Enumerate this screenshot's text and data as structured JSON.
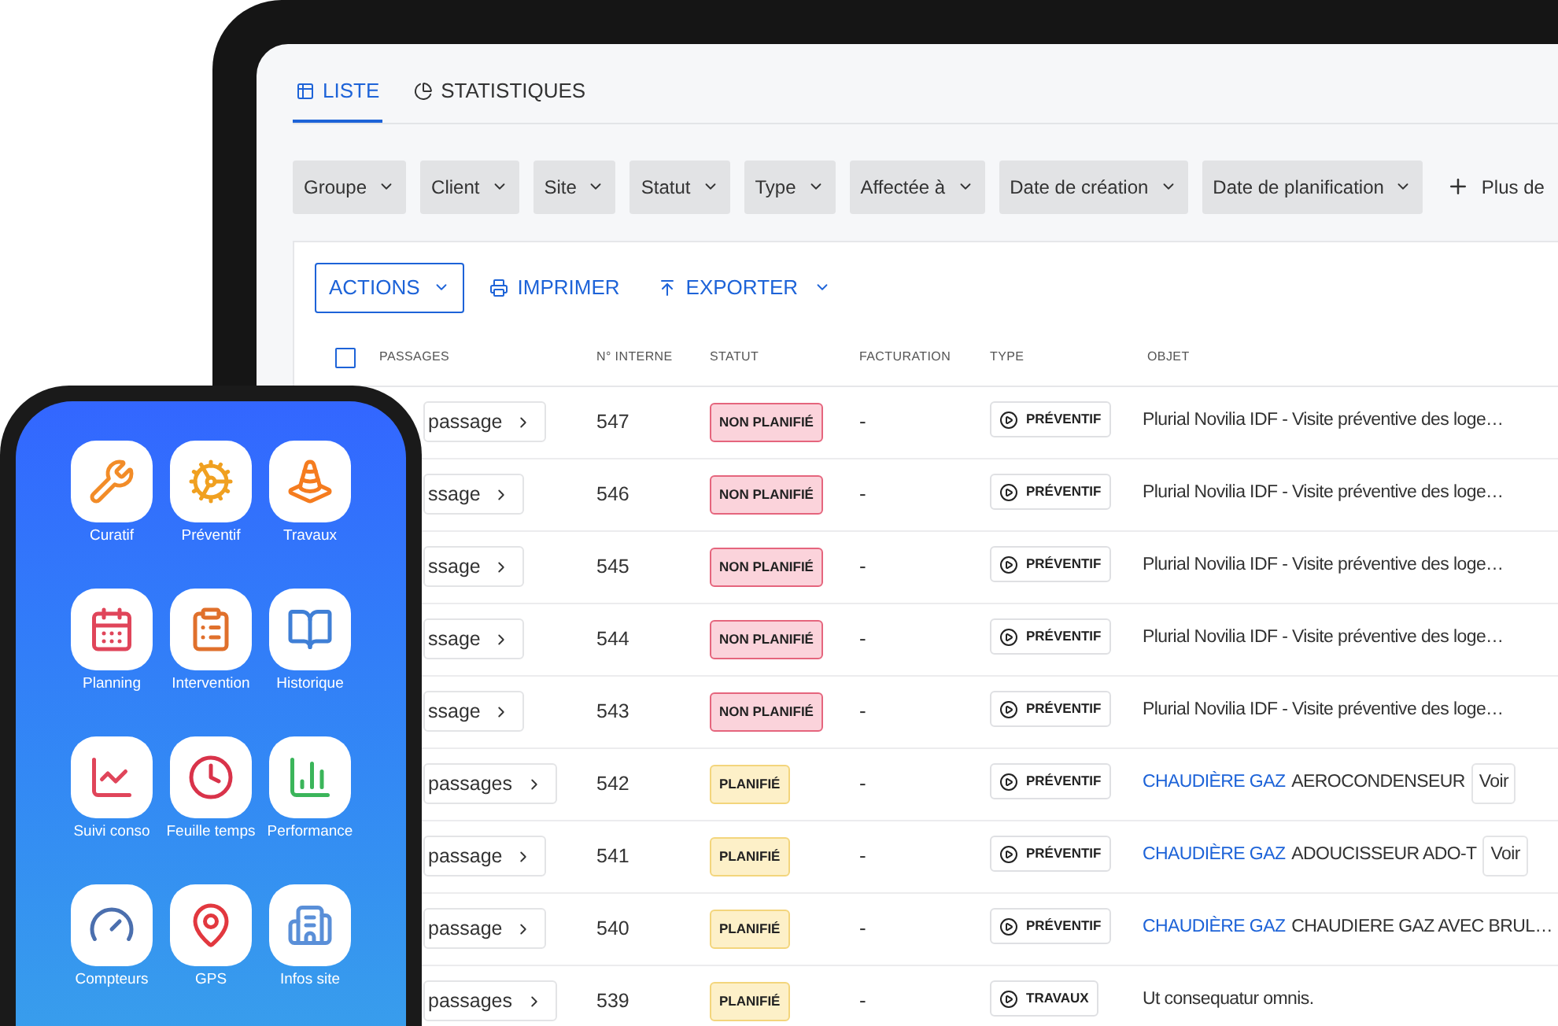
{
  "tabs": [
    {
      "label": "LISTE",
      "selected": true
    },
    {
      "label": "STATISTIQUES",
      "selected": false
    }
  ],
  "filters": [
    "Groupe",
    "Client",
    "Site",
    "Statut",
    "Type",
    "Affectée à",
    "Date de création",
    "Date de planification"
  ],
  "more_filters": "Plus de",
  "toolbar": {
    "actions": "ACTIONS",
    "print": "IMPRIMER",
    "export": "EXPORTER"
  },
  "table": {
    "select_all_checked": false,
    "columns": [
      "PASSAGES",
      "N° INTERNE",
      "STATUT",
      "FACTURATION",
      "TYPE",
      "OBJET"
    ],
    "rows": [
      {
        "passages": "passage",
        "number": "547",
        "status": {
          "label": "NON PLANIFIÉ",
          "kind": "unplanned"
        },
        "billing": "-",
        "type": "PRÉVENTIF",
        "object": {
          "text": "Plurial Novilia IDF - Visite préventive des loge…"
        }
      },
      {
        "passages": "ssage",
        "number": "546",
        "status": {
          "label": "NON PLANIFIÉ",
          "kind": "unplanned"
        },
        "billing": "-",
        "type": "PRÉVENTIF",
        "object": {
          "text": "Plurial Novilia IDF - Visite préventive des loge…"
        }
      },
      {
        "passages": "ssage",
        "number": "545",
        "status": {
          "label": "NON PLANIFIÉ",
          "kind": "unplanned"
        },
        "billing": "-",
        "type": "PRÉVENTIF",
        "object": {
          "text": "Plurial Novilia IDF - Visite préventive des loge…"
        }
      },
      {
        "passages": "ssage",
        "number": "544",
        "status": {
          "label": "NON PLANIFIÉ",
          "kind": "unplanned"
        },
        "billing": "-",
        "type": "PRÉVENTIF",
        "object": {
          "text": "Plurial Novilia IDF - Visite préventive des loge…"
        }
      },
      {
        "passages": "ssage",
        "number": "543",
        "status": {
          "label": "NON PLANIFIÉ",
          "kind": "unplanned"
        },
        "billing": "-",
        "type": "PRÉVENTIF",
        "object": {
          "text": "Plurial Novilia IDF - Visite préventive des loge…"
        }
      },
      {
        "passages": "passages",
        "number": "542",
        "status": {
          "label": "PLANIFIÉ",
          "kind": "planned"
        },
        "billing": "-",
        "type": "PRÉVENTIF",
        "object": {
          "link": "CHAUDIÈRE GAZ",
          "text": "AEROCONDENSEUR",
          "action": "Voir"
        }
      },
      {
        "passages": "passage",
        "number": "541",
        "status": {
          "label": "PLANIFIÉ",
          "kind": "planned"
        },
        "billing": "-",
        "type": "PRÉVENTIF",
        "object": {
          "link": "CHAUDIÈRE GAZ",
          "text": "ADOUCISSEUR ADO-T",
          "action": "Voir"
        }
      },
      {
        "passages": "passage",
        "number": "540",
        "status": {
          "label": "PLANIFIÉ",
          "kind": "planned"
        },
        "billing": "-",
        "type": "PRÉVENTIF",
        "object": {
          "link": "CHAUDIÈRE GAZ",
          "text": "CHAUDIERE GAZ AVEC BRUL…"
        }
      },
      {
        "passages": "passages",
        "number": "539",
        "status": {
          "label": "PLANIFIÉ",
          "kind": "planned"
        },
        "billing": "-",
        "type": "TRAVAUX",
        "object": {
          "text": "Ut consequatur omnis."
        }
      }
    ]
  },
  "phone": {
    "apps": [
      "Curatif",
      "Préventif",
      "Travaux",
      "Planning",
      "Intervention",
      "Historique",
      "Suivi conso",
      "Feuille temps",
      "Performance",
      "Compteurs",
      "GPS",
      "Infos site"
    ]
  }
}
